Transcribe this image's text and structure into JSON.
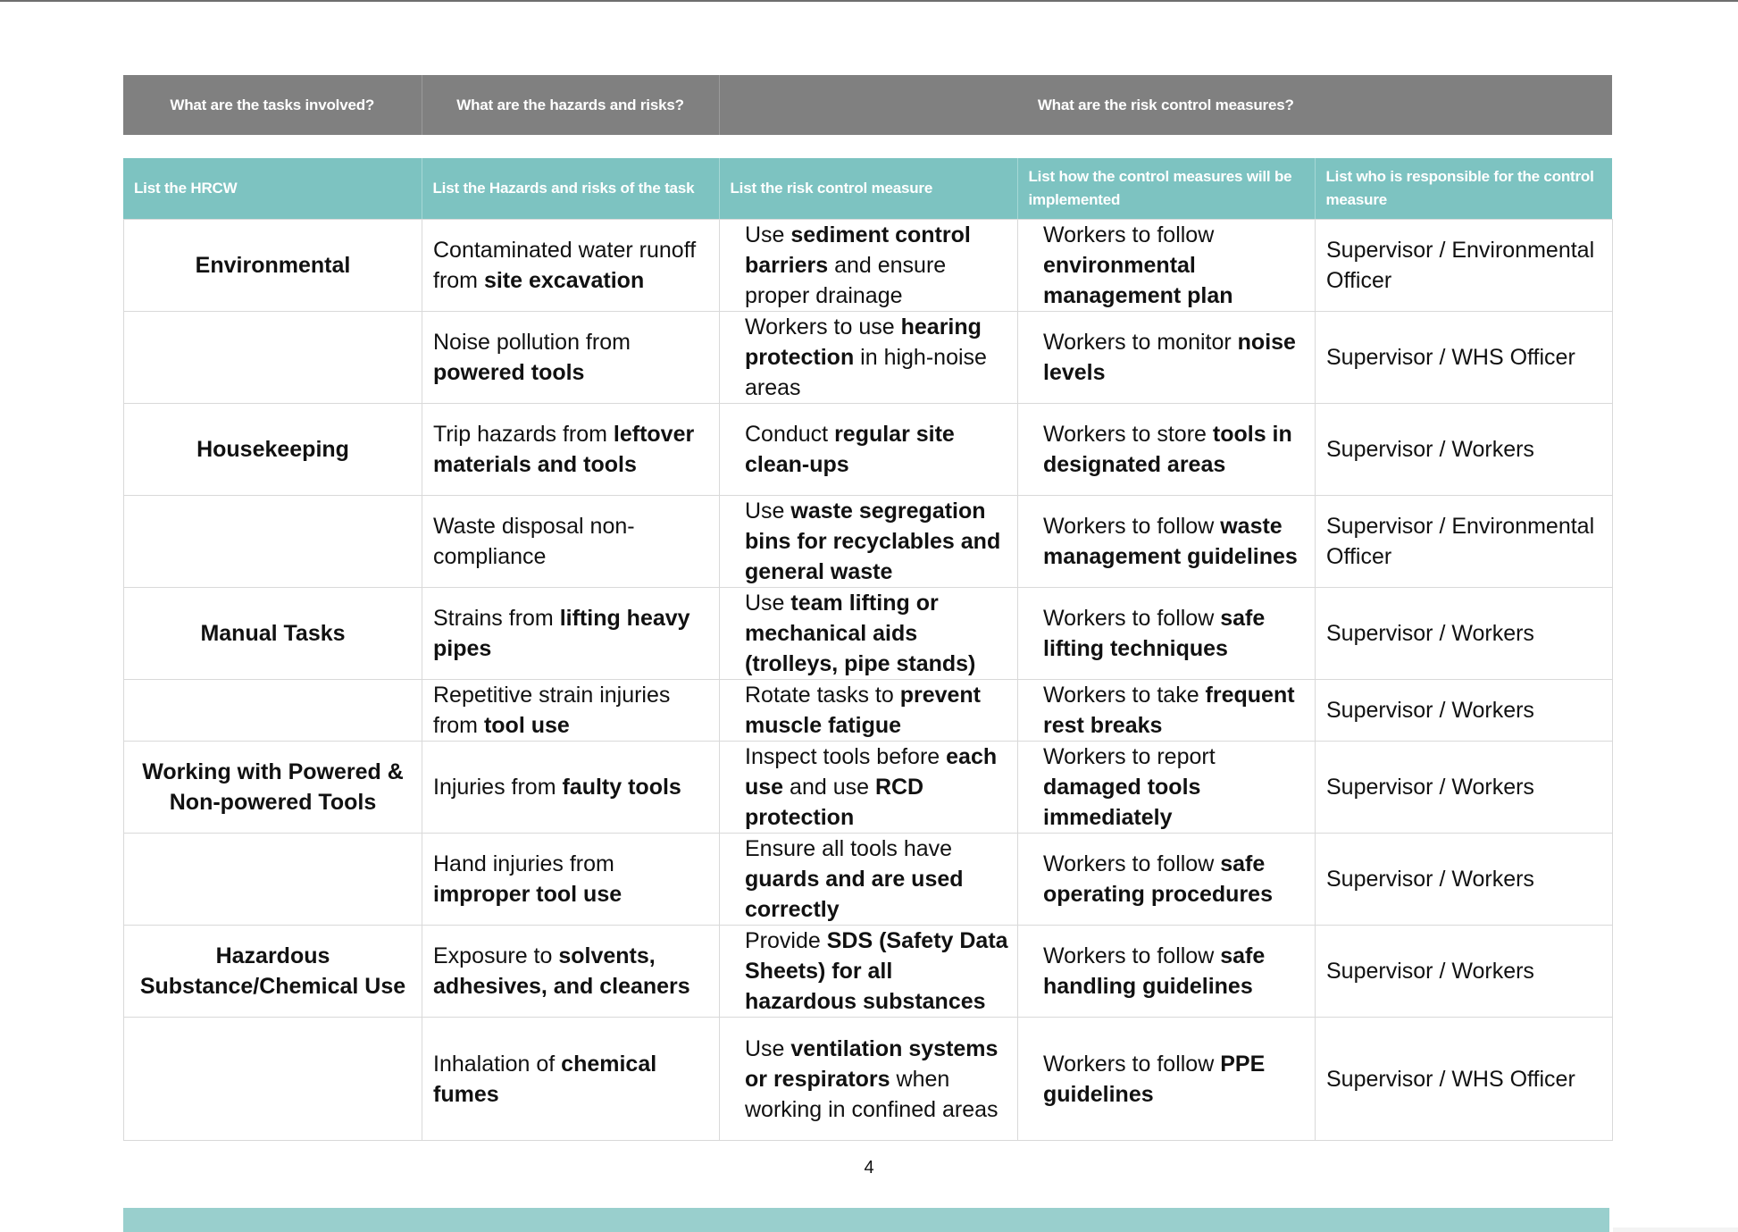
{
  "section_headers": [
    "What are the tasks involved?",
    "What are the hazards and risks?",
    "What are the risk control measures?"
  ],
  "column_headers": [
    "List the HRCW",
    "List the Hazards and risks of the task",
    "List the risk control measure",
    "List how the control measures will be implemented",
    "List who is responsible for the control measure"
  ],
  "rows": [
    {
      "task": "Environmental",
      "hazard": [
        {
          "t": "Contaminated water runoff from "
        },
        {
          "t": "site excavation",
          "b": true
        }
      ],
      "control": [
        {
          "t": "Use "
        },
        {
          "t": "sediment control barriers",
          "b": true
        },
        {
          "t": " and ensure proper drainage"
        }
      ],
      "implementation": [
        {
          "t": "Workers to follow "
        },
        {
          "t": "environmental management plan",
          "b": true
        }
      ],
      "responsible": "Supervisor / Environmental Officer"
    },
    {
      "task": "",
      "hazard": [
        {
          "t": "Noise pollution from "
        },
        {
          "t": "powered tools",
          "b": true
        }
      ],
      "control": [
        {
          "t": "Workers to use "
        },
        {
          "t": "hearing protection",
          "b": true
        },
        {
          "t": " in high-noise areas"
        }
      ],
      "implementation": [
        {
          "t": "Workers to monitor "
        },
        {
          "t": "noise levels",
          "b": true
        }
      ],
      "responsible": "Supervisor / WHS Officer"
    },
    {
      "task": "Housekeeping",
      "hazard": [
        {
          "t": "Trip hazards from "
        },
        {
          "t": "leftover materials and tools",
          "b": true
        }
      ],
      "control": [
        {
          "t": "Conduct "
        },
        {
          "t": "regular site clean-ups",
          "b": true
        }
      ],
      "implementation": [
        {
          "t": "Workers to store "
        },
        {
          "t": "tools in designated areas",
          "b": true
        }
      ],
      "responsible": "Supervisor / Workers"
    },
    {
      "task": "",
      "hazard": [
        {
          "t": "Waste disposal non-compliance"
        }
      ],
      "control": [
        {
          "t": "Use "
        },
        {
          "t": "waste segregation bins for recyclables and general waste",
          "b": true
        }
      ],
      "implementation": [
        {
          "t": "Workers to follow "
        },
        {
          "t": "waste management guidelines",
          "b": true
        }
      ],
      "responsible": "Supervisor / Environmental Officer"
    },
    {
      "task": "Manual Tasks",
      "hazard": [
        {
          "t": "Strains from "
        },
        {
          "t": "lifting heavy pipes",
          "b": true
        }
      ],
      "control": [
        {
          "t": "Use "
        },
        {
          "t": "team lifting or mechanical aids (trolleys, pipe stands)",
          "b": true
        }
      ],
      "implementation": [
        {
          "t": "Workers to follow "
        },
        {
          "t": "safe lifting techniques",
          "b": true
        }
      ],
      "responsible": "Supervisor / Workers"
    },
    {
      "task": "",
      "hazard": [
        {
          "t": "Repetitive strain injuries from "
        },
        {
          "t": "tool use",
          "b": true
        }
      ],
      "control": [
        {
          "t": "Rotate tasks to "
        },
        {
          "t": "prevent muscle fatigue",
          "b": true
        }
      ],
      "implementation": [
        {
          "t": "Workers to take "
        },
        {
          "t": "frequent rest breaks",
          "b": true
        }
      ],
      "responsible": "Supervisor / Workers"
    },
    {
      "task": "Working with Powered & Non-powered Tools",
      "hazard": [
        {
          "t": "Injuries from "
        },
        {
          "t": "faulty tools",
          "b": true
        }
      ],
      "control": [
        {
          "t": "Inspect tools before "
        },
        {
          "t": "each use",
          "b": true
        },
        {
          "t": " and use "
        },
        {
          "t": "RCD protection",
          "b": true
        }
      ],
      "implementation": [
        {
          "t": "Workers to report "
        },
        {
          "t": "damaged tools immediately",
          "b": true
        }
      ],
      "responsible": "Supervisor / Workers"
    },
    {
      "task": "",
      "hazard": [
        {
          "t": "Hand injuries from "
        },
        {
          "t": "improper tool use",
          "b": true
        }
      ],
      "control": [
        {
          "t": "Ensure all tools have "
        },
        {
          "t": "guards and are used correctly",
          "b": true
        }
      ],
      "implementation": [
        {
          "t": "Workers to follow "
        },
        {
          "t": "safe operating procedures",
          "b": true
        }
      ],
      "responsible": "Supervisor / Workers"
    },
    {
      "task": "Hazardous Substance/Chemical Use",
      "hazard": [
        {
          "t": "Exposure to "
        },
        {
          "t": "solvents, adhesives, and cleaners",
          "b": true
        }
      ],
      "control": [
        {
          "t": "Provide "
        },
        {
          "t": "SDS (Safety Data Sheets) for all hazardous substances",
          "b": true
        }
      ],
      "implementation": [
        {
          "t": "Workers to follow "
        },
        {
          "t": "safe handling guidelines",
          "b": true
        }
      ],
      "responsible": "Supervisor / Workers"
    },
    {
      "task": "",
      "hazard": [
        {
          "t": "Inhalation of "
        },
        {
          "t": "chemical fumes",
          "b": true
        }
      ],
      "control": [
        {
          "t": "Use "
        },
        {
          "t": "ventilation systems or respirators",
          "b": true
        },
        {
          "t": " when working in confined areas"
        }
      ],
      "implementation": [
        {
          "t": "Workers to follow "
        },
        {
          "t": "PPE guidelines",
          "b": true
        }
      ],
      "responsible": "Supervisor / WHS Officer"
    }
  ],
  "page_number": "4",
  "colors": {
    "section_header_bg": "#808080",
    "column_header_bg": "#7dc3c1",
    "footer_bar": "#99cfcd"
  }
}
